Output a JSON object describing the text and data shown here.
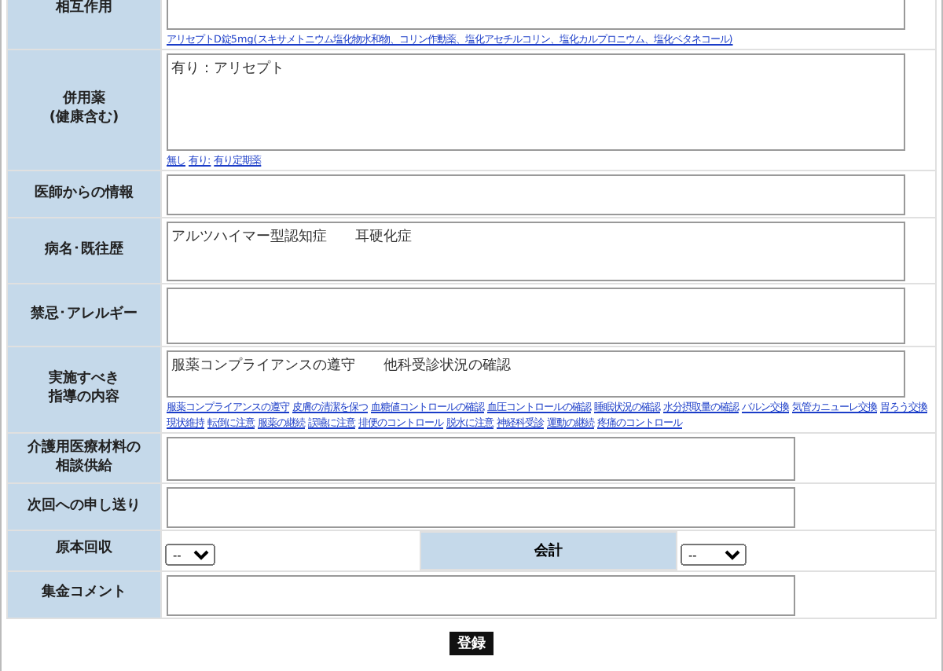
{
  "rows": [
    {
      "kind": "textarea",
      "label": [
        "相互作用"
      ],
      "value": "",
      "links": [
        "アリセプトD錠5mg(スキサメトニウム塩化物水和物、コリン作動薬、塩化アセチルコリン、塩化カルプロニウム、塩化ベタネコール)"
      ]
    },
    {
      "kind": "textarea",
      "label": [
        "併用薬",
        "(健康含む)"
      ],
      "value": "有り：アリセプト",
      "links": [
        "無し",
        "有り:",
        "有り定期薬"
      ]
    },
    {
      "kind": "textarea",
      "label": [
        "医師からの情報"
      ],
      "value": ""
    },
    {
      "kind": "textarea",
      "label": [
        "病名･既往歴"
      ],
      "value": "アルツハイマー型認知症　　耳硬化症"
    },
    {
      "kind": "textarea",
      "label": [
        "禁忌･アレルギー"
      ],
      "value": ""
    },
    {
      "kind": "textarea",
      "label": [
        "実施すべき",
        "指導の内容"
      ],
      "value": "服薬コンプライアンスの遵守　　他科受診状況の確認",
      "links": [
        "服薬コンプライアンスの遵守",
        "皮膚の清潔を保つ",
        "血糖値コントロールの確認",
        "血圧コントロールの確認",
        "睡眠状況の確認",
        "水分摂取量の確認",
        "バルン交換",
        "気管カニューレ交換",
        "胃ろう交換",
        "現状維持",
        "転倒に注意",
        "服薬の継続",
        "誤嚥に注意",
        "排便のコントロール",
        "脱水に注意",
        "神経科受診",
        "運動の継続",
        "疼痛のコントロール"
      ]
    },
    {
      "kind": "textarea",
      "label": [
        "介護用医療材料の",
        "相談供給"
      ],
      "value": ""
    },
    {
      "kind": "textarea",
      "label": [
        "次回への申し送り"
      ],
      "value": ""
    },
    {
      "kind": "selects",
      "label": [
        "原本回収"
      ],
      "value": "--",
      "label2": "会計",
      "value2": "--"
    },
    {
      "kind": "textarea",
      "label": [
        "集金コメント"
      ],
      "value": ""
    }
  ],
  "submit": "登録"
}
